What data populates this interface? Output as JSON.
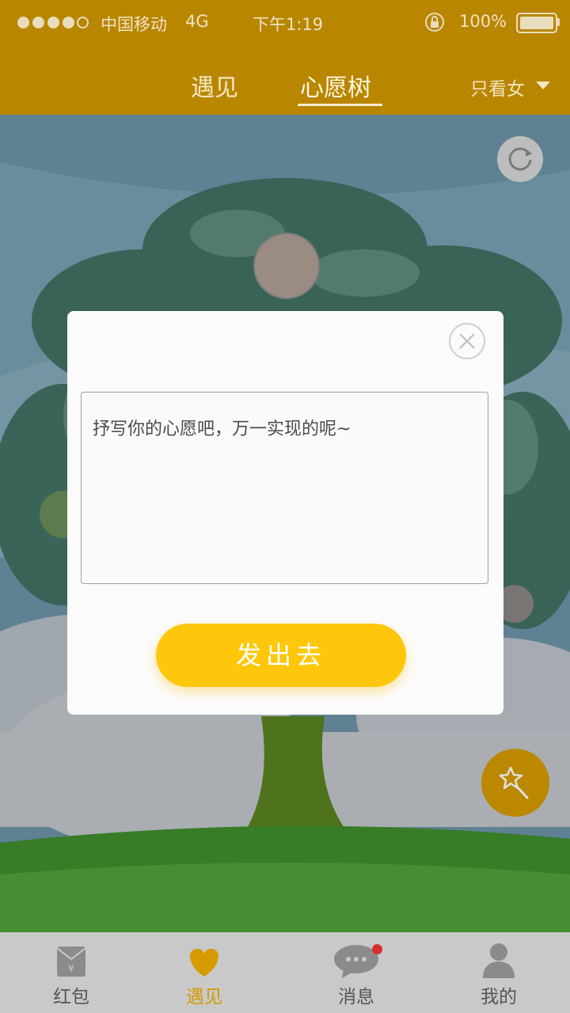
{
  "status_bar": {
    "carrier": "中国移动",
    "network": "4G",
    "time": "下午1:19",
    "battery_percent": "100%",
    "signal_bars_filled": 4,
    "signal_bars_total": 5
  },
  "nav": {
    "tabs": [
      {
        "label": "遇见",
        "active": false
      },
      {
        "label": "心愿树",
        "active": true
      }
    ],
    "filter_label": "只看女"
  },
  "dialog": {
    "input_placeholder": "抒写你的心愿吧，万一实现的呢~",
    "input_value": "",
    "submit_label": "发出去"
  },
  "tabbar": {
    "items": [
      {
        "label": "红包",
        "icon": "red-packet-icon",
        "active": false
      },
      {
        "label": "遇见",
        "icon": "heart-icon",
        "active": true
      },
      {
        "label": "消息",
        "icon": "chat-bubble-icon",
        "active": false,
        "badge": true
      },
      {
        "label": "我的",
        "icon": "person-icon",
        "active": false
      }
    ]
  },
  "colors": {
    "header": "#b98600",
    "accent": "#d59b00",
    "button": "#fec70b",
    "badge": "#d62e2e"
  }
}
